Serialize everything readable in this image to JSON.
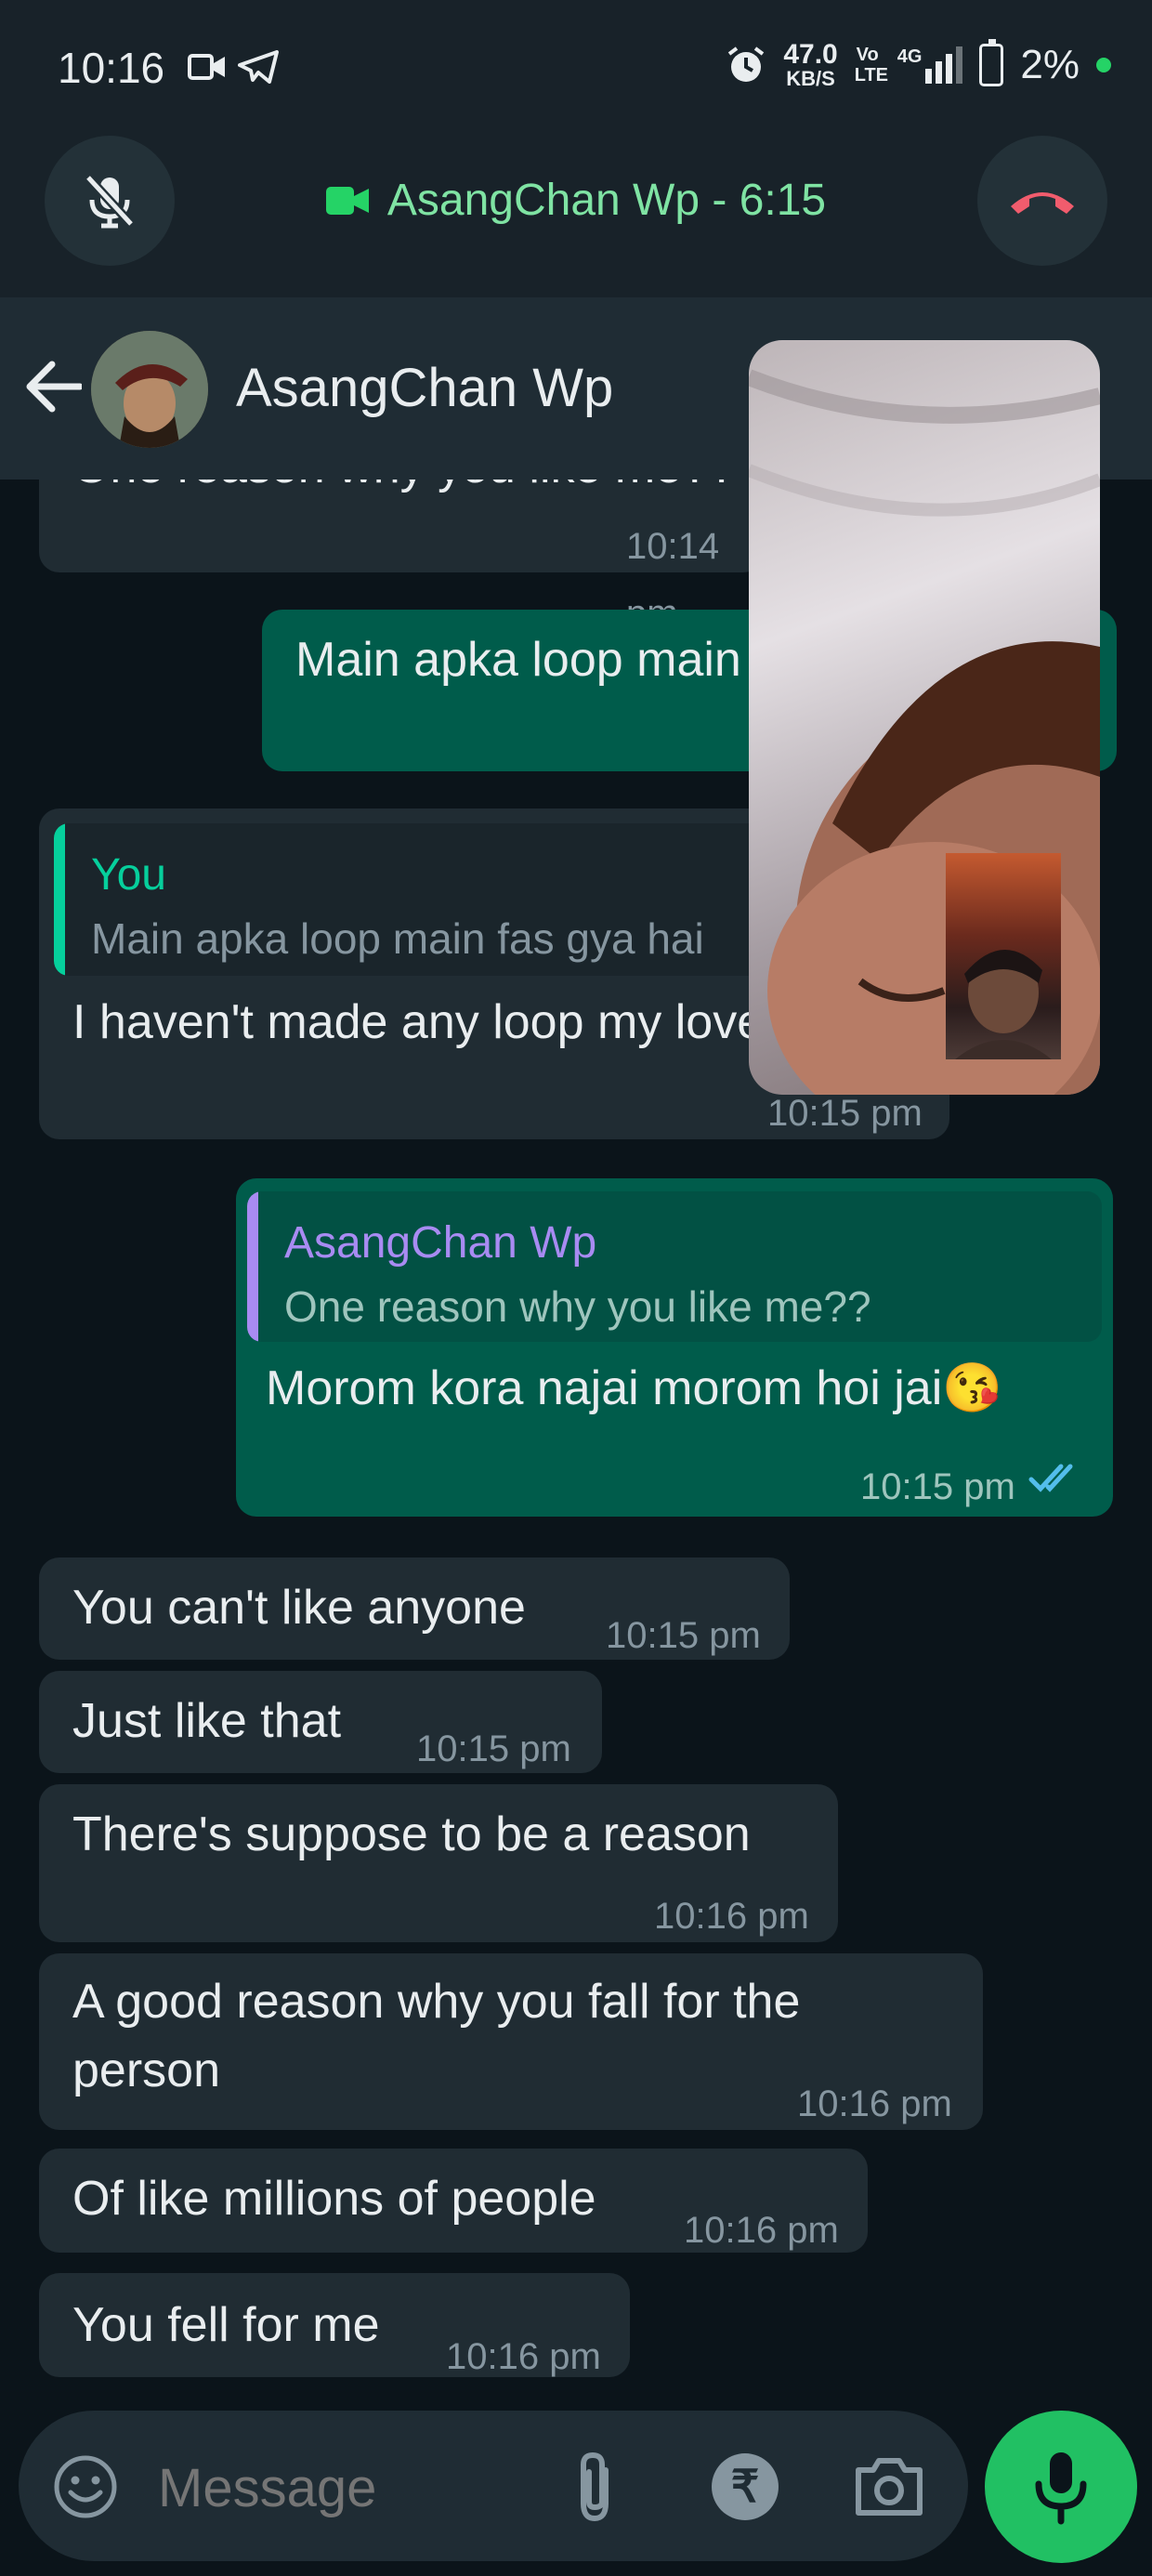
{
  "status_bar": {
    "time": "10:16",
    "net_speed": "47.0",
    "net_unit": "KB/S",
    "volte": "Vo LTE",
    "signal": "4G",
    "battery": "2%"
  },
  "call": {
    "title": "AsangChan Wp - 6:15",
    "mute_icon": "mic-off-icon",
    "end_icon": "call-end-icon"
  },
  "header": {
    "contact_name": "AsangChan Wp"
  },
  "messages": [
    {
      "dir": "in",
      "text": "One reason why you like me??",
      "time": "10:14 pm"
    },
    {
      "dir": "out",
      "text": "Main apka loop main fas gya hai",
      "time": ""
    },
    {
      "dir": "in",
      "quote_name": "You",
      "quote_text": "Main apka loop main fas gya hai",
      "text": "I haven't made any loop my love",
      "time": "10:15 pm"
    },
    {
      "dir": "out",
      "quote_name": "AsangChan Wp",
      "quote_text": "One reason why you like me??",
      "text": "Morom kora najai morom hoi jai",
      "emoji": "😘",
      "time": "10:15 pm"
    },
    {
      "dir": "in",
      "text": "You can't like anyone",
      "time": "10:15 pm"
    },
    {
      "dir": "in",
      "text": "Just like that",
      "time": "10:15 pm"
    },
    {
      "dir": "in",
      "text": "There's suppose to be a reason",
      "time": "10:16 pm"
    },
    {
      "dir": "in",
      "text": "A good reason why you fall for the",
      "text2": "person",
      "time": "10:16 pm"
    },
    {
      "dir": "in",
      "text": "Of like millions of people",
      "time": "10:16 pm"
    },
    {
      "dir": "in",
      "text": "You fell for me",
      "time": "10:16 pm"
    }
  ],
  "input": {
    "placeholder": "Message",
    "rupee": "₹"
  },
  "colors": {
    "background": "#0b141a",
    "incoming": "#202c33",
    "outgoing": "#005c4b",
    "accent": "#25d366"
  }
}
